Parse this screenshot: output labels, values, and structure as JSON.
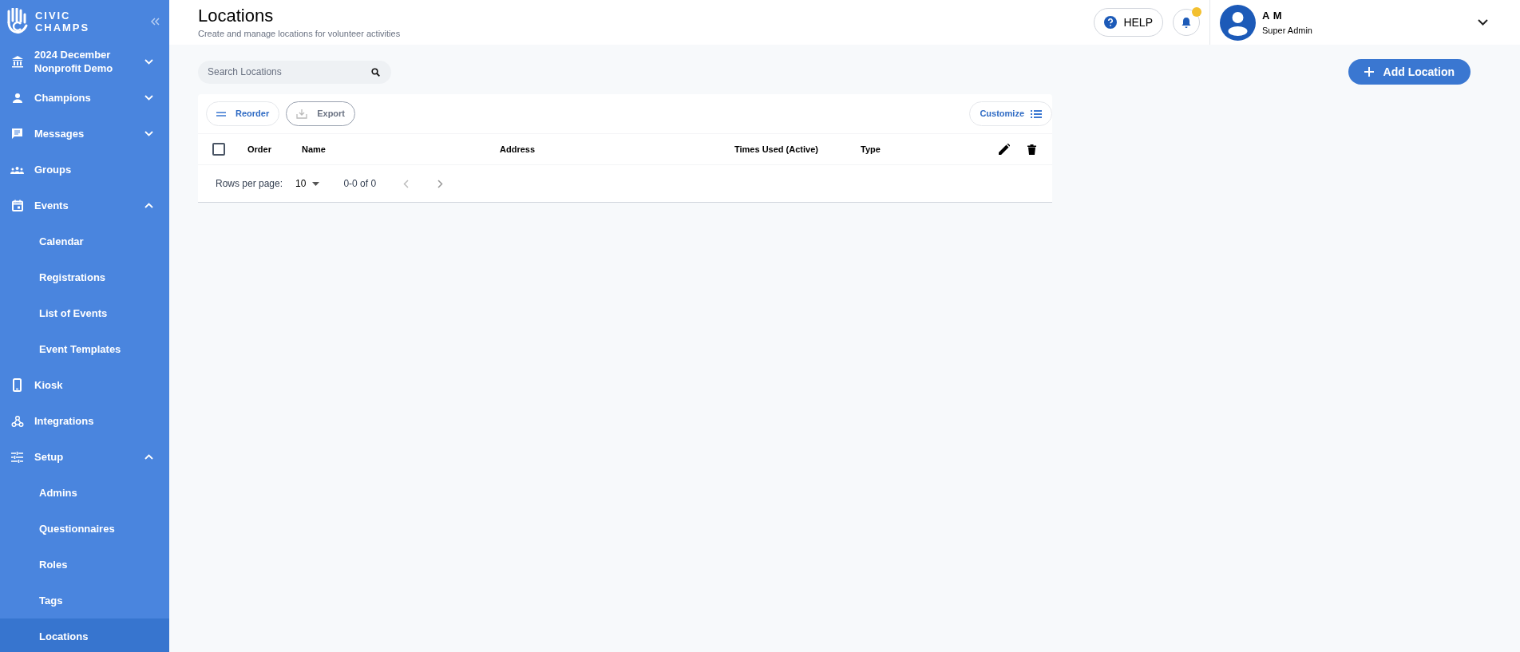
{
  "brand": {
    "line_1": "CIVIC",
    "line_2": "CHAMPS"
  },
  "sidebar": {
    "items": [
      {
        "kind": "org",
        "label": "2024 December Nonprofit Demo",
        "expanded": false,
        "selected": false
      },
      {
        "kind": "link",
        "label": "Champions",
        "expanded": false,
        "selected": false
      },
      {
        "kind": "link",
        "label": "Messages",
        "expanded": false,
        "selected": false
      },
      {
        "kind": "link",
        "label": "Groups",
        "selected": false
      },
      {
        "kind": "link",
        "label": "Events",
        "expanded": true,
        "selected": false,
        "children": [
          {
            "label": "Calendar",
            "selected": false
          },
          {
            "label": "Registrations",
            "selected": false
          },
          {
            "label": "List of Events",
            "selected": false
          },
          {
            "label": "Event Templates",
            "selected": false
          }
        ]
      },
      {
        "kind": "link",
        "label": "Kiosk",
        "selected": false
      },
      {
        "kind": "link",
        "label": "Integrations",
        "selected": false
      },
      {
        "kind": "link",
        "label": "Setup",
        "expanded": true,
        "selected": false,
        "children": [
          {
            "label": "Admins",
            "selected": false
          },
          {
            "label": "Questionnaires",
            "selected": false
          },
          {
            "label": "Roles",
            "selected": false
          },
          {
            "label": "Tags",
            "selected": false
          },
          {
            "label": "Locations",
            "selected": true
          }
        ]
      }
    ]
  },
  "header": {
    "title": "Locations",
    "subtitle": "Create and manage locations for volunteer activities",
    "help": "HELP",
    "notification_dot": true,
    "user": {
      "name": "A M",
      "role": "Super Admin"
    }
  },
  "search": {
    "placeholder": "Search Locations"
  },
  "add_button": "Add Location",
  "toolbar": {
    "buttons": [
      {
        "label": "Reorder",
        "disabled": false
      },
      {
        "label": "Export",
        "disabled": true
      }
    ],
    "customize": "Customize"
  },
  "table": {
    "select_all_checked": false,
    "columns": [
      "Order",
      "Name",
      "Address",
      "Times Used (Active)",
      "Type"
    ]
  },
  "pagination": {
    "rows_per_page_label": "Rows per page:",
    "rows_per_page": "10",
    "range": "0-0 of 0"
  }
}
